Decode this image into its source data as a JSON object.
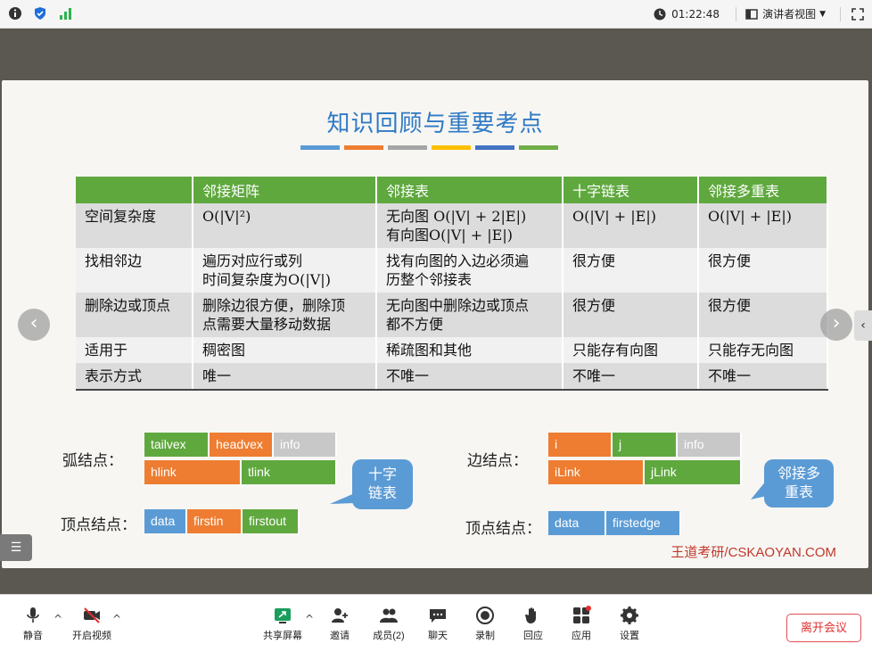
{
  "topbar": {
    "time": "01:22:48",
    "view_mode": "演讲者视图"
  },
  "slide": {
    "title": "知识回顾与重要考点",
    "color_bars": [
      "#5b9bd5",
      "#ee7d31",
      "#a5a5a5",
      "#ffc000",
      "#4472c4",
      "#70ad47"
    ],
    "table": {
      "headers": [
        "",
        "邻接矩阵",
        "邻接表",
        "十字链表",
        "邻接多重表"
      ],
      "rows": [
        [
          "空间复杂度",
          "O(|V|²)",
          "无向图 O(|V| + 2|E|)\n有向图O(|V| + |E|)",
          "O(|V| + |E|)",
          "O(|V| + |E|)"
        ],
        [
          "找相邻边",
          "遍历对应行或列\n时间复杂度为O(|V|)",
          "找有向图的入边必须遍\n历整个邻接表",
          "很方便",
          "很方便"
        ],
        [
          "删除边或顶点",
          "删除边很方便，删除顶\n点需要大量移动数据",
          "无向图中删除边或顶点\n都不方便",
          "很方便",
          "很方便"
        ],
        [
          "适用于",
          "稠密图",
          "稀疏图和其他",
          "只能存有向图",
          "只能存无向图"
        ],
        [
          "表示方式",
          "唯一",
          "不唯一",
          "不唯一",
          "不唯一"
        ]
      ]
    },
    "cross_list": {
      "arc_label": "弧结点：",
      "arc_row1": [
        "tailvex",
        "headvex",
        "info"
      ],
      "arc_row2": [
        "hlink",
        "tlink"
      ],
      "vertex_label": "顶点结点：",
      "vertex_row": [
        "data",
        "firstin",
        "firstout"
      ],
      "bubble": "十字\n链表"
    },
    "multi_list": {
      "edge_label": "边结点：",
      "edge_row1": [
        "i",
        "j",
        "info"
      ],
      "edge_row2": [
        "iLink",
        "jLink"
      ],
      "vertex_label": "顶点结点：",
      "vertex_row": [
        "data",
        "firstedge"
      ],
      "bubble": "邻接多\n重表"
    },
    "brand": "王道考研/CSKAOYAN.COM"
  },
  "toolbar": {
    "mute": "静音",
    "video": "开启视频",
    "share": "共享屏幕",
    "invite": "邀请",
    "members": "成员(2)",
    "chat": "聊天",
    "record": "录制",
    "react": "回应",
    "apps": "应用",
    "settings": "设置",
    "leave": "离开会议"
  },
  "colors": {
    "green": "#5fa83e",
    "orange": "#ee7d31",
    "gray": "#c8c8c8",
    "blue": "#5b9bd5",
    "title": "#2f7ac4",
    "leave": "#e03030"
  }
}
